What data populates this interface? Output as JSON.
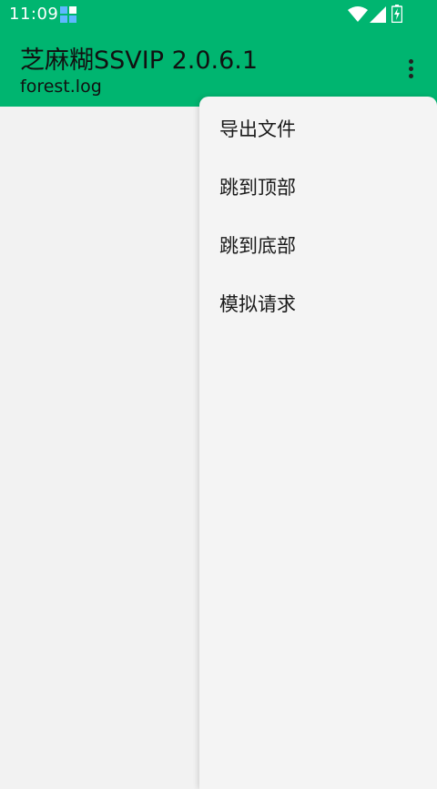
{
  "status_bar": {
    "time": "11:09"
  },
  "app_bar": {
    "title": "芝麻糊SSVIP 2.0.6.1",
    "subtitle": "forest.log"
  },
  "menu": {
    "items": [
      {
        "label": "导出文件"
      },
      {
        "label": "跳到顶部"
      },
      {
        "label": "跳到底部"
      },
      {
        "label": "模拟请求"
      }
    ]
  },
  "colors": {
    "accent": "#00b570",
    "background": "#f2f2f2",
    "menu_background": "#f4f4f4"
  },
  "icons": {
    "status_app": "app-notification-icon",
    "wifi": "wifi-icon",
    "signal": "signal-icon",
    "battery": "battery-charging-icon",
    "overflow": "more-vert-icon"
  }
}
